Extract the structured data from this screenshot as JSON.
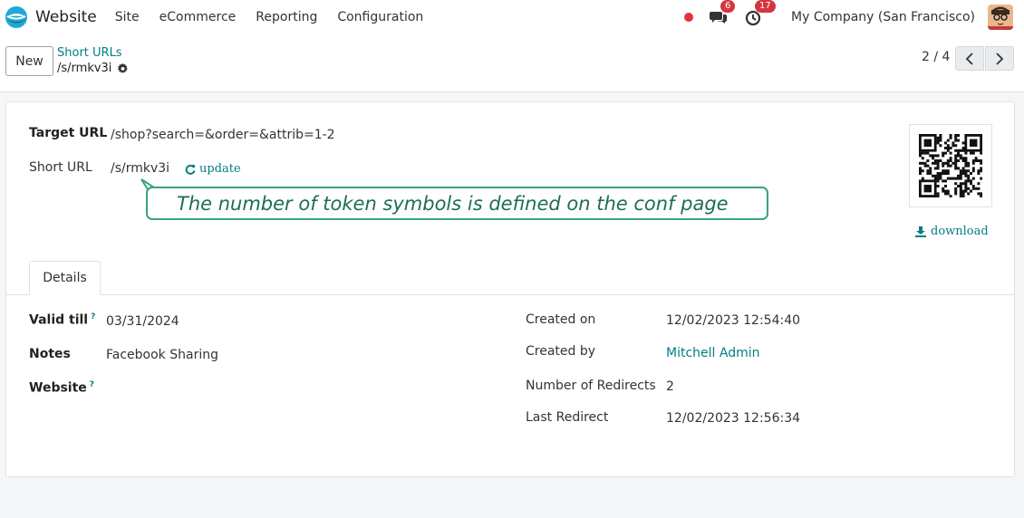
{
  "app": {
    "name": "Website"
  },
  "menu": [
    "Site",
    "eCommerce",
    "Reporting",
    "Configuration"
  ],
  "navbar": {
    "messages_count": "6",
    "activities_count": "17",
    "company": "My Company (San Francisco)"
  },
  "control_panel": {
    "new_label": "New",
    "breadcrumb": "Short URLs",
    "record_title": "/s/rmkv3i",
    "pager": "2 / 4"
  },
  "form": {
    "target_url_label": "Target URL",
    "target_url_value": "/shop?search=&order=&attrib=1-2",
    "short_url_label": "Short URL",
    "short_url_value": "/s/rmkv3i",
    "update_label": "update",
    "download_label": "download",
    "tab_label": "Details",
    "valid_till_label": "Valid till",
    "valid_till_value": "03/31/2024",
    "notes_label": "Notes",
    "notes_value": "Facebook Sharing",
    "website_label": "Website",
    "help_mark": "?",
    "created_on_label": "Created on",
    "created_on_value": "12/02/2023 12:54:40",
    "created_by_label": "Created by",
    "created_by_value": "Mitchell Admin",
    "redirects_label": "Number of Redirects",
    "redirects_value": "2",
    "last_redirect_label": "Last Redirect",
    "last_redirect_value": "12/02/2023 12:56:34"
  },
  "annotation": {
    "text": "The number of token symbols is defined on the conf page"
  },
  "colors": {
    "accent": "#017e84",
    "badge": "#d6363e",
    "callout_border": "#36a57e"
  }
}
